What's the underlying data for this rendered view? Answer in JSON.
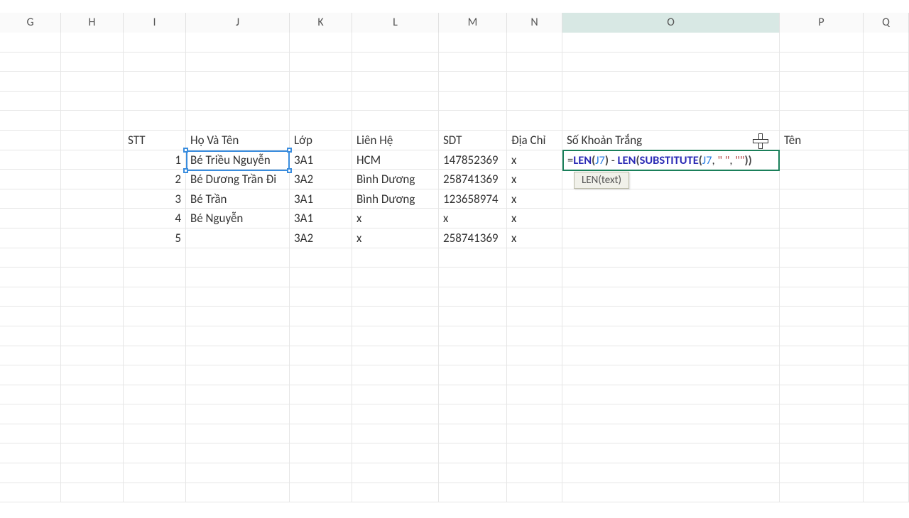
{
  "columns": [
    "G",
    "H",
    "I",
    "J",
    "K",
    "L",
    "M",
    "N",
    "O",
    "P",
    "Q"
  ],
  "active_column": "O",
  "headers_row": {
    "I": "STT",
    "J": "Họ Và Tên",
    "K": "Lớp",
    "L": "Liên Hệ",
    "M": "SDT",
    "N": "Địa Chỉ",
    "O": "Số Khoản Trắng",
    "P": "Tên"
  },
  "data_rows": [
    {
      "I": "1",
      "J": "Bé Triều Nguyễn",
      "K": "3A1",
      "L": "HCM",
      "M": "147852369",
      "N": "x"
    },
    {
      "I": "2",
      "J": "Bé Dương Trần Đi",
      "K": "3A2",
      "L": "Bình Dương",
      "M": "258741369",
      "N": "x"
    },
    {
      "I": "3",
      "J": "Bé Trần",
      "K": "3A1",
      "L": "Bình Dương",
      "M": "123658974",
      "N": "x"
    },
    {
      "I": "4",
      "J": "Bé Nguyễn",
      "K": "3A1",
      "L": "x",
      "M": "x",
      "N": "x"
    },
    {
      "I": "5",
      "J": "",
      "K": "3A2",
      "L": "x",
      "M": "258741369",
      "N": "x"
    }
  ],
  "formula_parts": {
    "eq": "=",
    "fn1": "LEN",
    "open1": "(",
    "ref1": "J7",
    "close1": ")",
    "minus": " - ",
    "fn2": "LEN",
    "open2": "(",
    "fn3": "SUBSTITUTE",
    "open3": "(",
    "ref2": "J7",
    "comma1": ", ",
    "str1": "\" \"",
    "comma2": ", ",
    "str2": "\"\"",
    "close3": ")",
    "close2": ")"
  },
  "tooltip": "LEN(text)"
}
